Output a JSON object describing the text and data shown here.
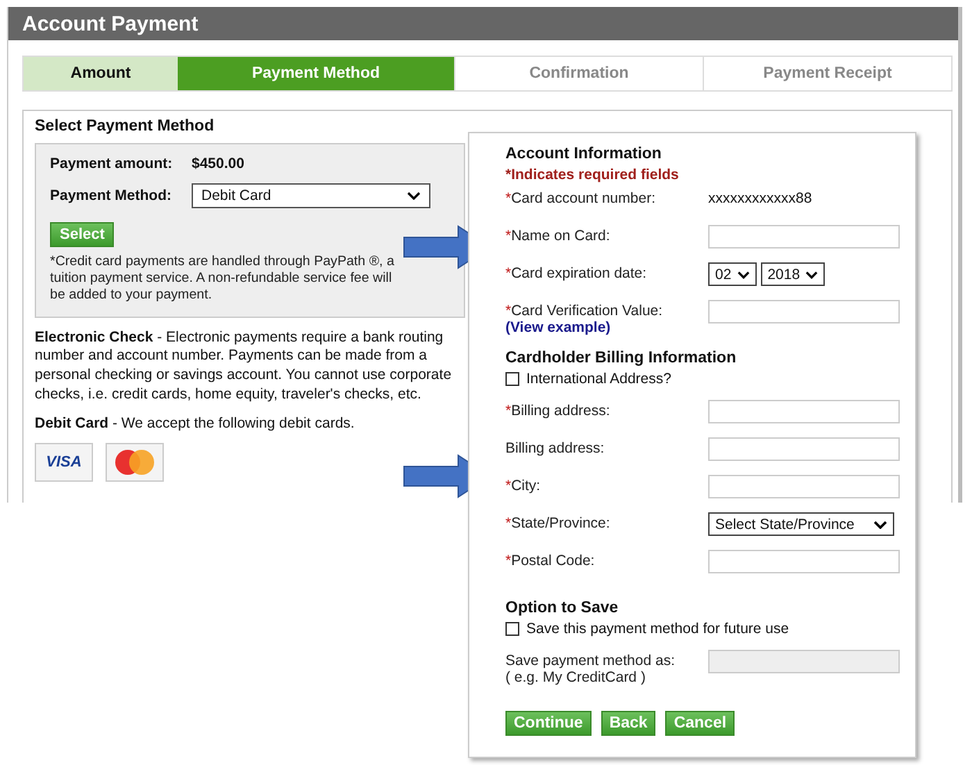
{
  "window": {
    "title": "Account Payment"
  },
  "steps": [
    {
      "label": "Amount",
      "selected": false,
      "completed": true
    },
    {
      "label": "Payment Method",
      "selected": true,
      "completed": false
    },
    {
      "label": "Confirmation",
      "selected": false,
      "completed": false
    },
    {
      "label": "Payment Receipt",
      "selected": false,
      "completed": false
    }
  ],
  "select_section": {
    "title": "Select Payment Method",
    "amount_label": "Payment amount:",
    "amount": "$450.00",
    "method_label": "Payment Method:",
    "method_value": "Debit Card",
    "button": "Select",
    "note": "*Credit card payments are handled through PayPath ®, a tuition payment service. A non-refundable service fee will be added to your payment."
  },
  "descriptions": [
    "**Electronic Check** - Electronic payments require a bank routing number and account number. Payments can be made from a personal checking or savings account. You cannot use corporate checks, i.e. credit cards, home equity, traveler's checks, etc.",
    "**Debit Card** - We accept the following debit cards."
  ],
  "cards": [
    {
      "kind": "visa",
      "label": "VISA"
    },
    {
      "kind": "mastercard"
    }
  ],
  "account_info": {
    "title": "Account Information",
    "required_note": "*Indicates required fields",
    "fields": [
      {
        "kind": "text",
        "asterisk": "*",
        "label": "Card account number:",
        "value": "xxxxxxxxxxxx88"
      },
      {
        "kind": "input",
        "asterisk": "*",
        "label": "Name on Card:"
      },
      {
        "kind": "date",
        "asterisk": "*",
        "label": "Card expiration date:",
        "month": "02",
        "year": "2018"
      },
      {
        "kind": "input",
        "asterisk": "*",
        "label": "Card Verification Value:",
        "link": "(View example)"
      }
    ]
  },
  "billing": {
    "title": "Cardholder Billing Information",
    "international": {
      "label": "International Address?",
      "checked": false
    },
    "fields": [
      {
        "kind": "input",
        "asterisk": "*",
        "label": "Billing address:"
      },
      {
        "kind": "input",
        "label": "Billing address:"
      },
      {
        "kind": "input",
        "asterisk": "*",
        "label": "City:"
      },
      {
        "kind": "select",
        "asterisk": "*",
        "label": "State/Province:",
        "value": "Select State/Province"
      },
      {
        "kind": "input",
        "asterisk": "*",
        "label": "Postal Code:"
      }
    ]
  },
  "save_option": {
    "title": "Option to Save",
    "checkbox": {
      "label": "Save this payment method for future use",
      "checked": false
    },
    "name_label": "Save payment method as:",
    "name_hint": "( e.g. My CreditCard )",
    "name_disabled": true
  },
  "buttons": [
    "Continue",
    "Back",
    "Cancel"
  ]
}
